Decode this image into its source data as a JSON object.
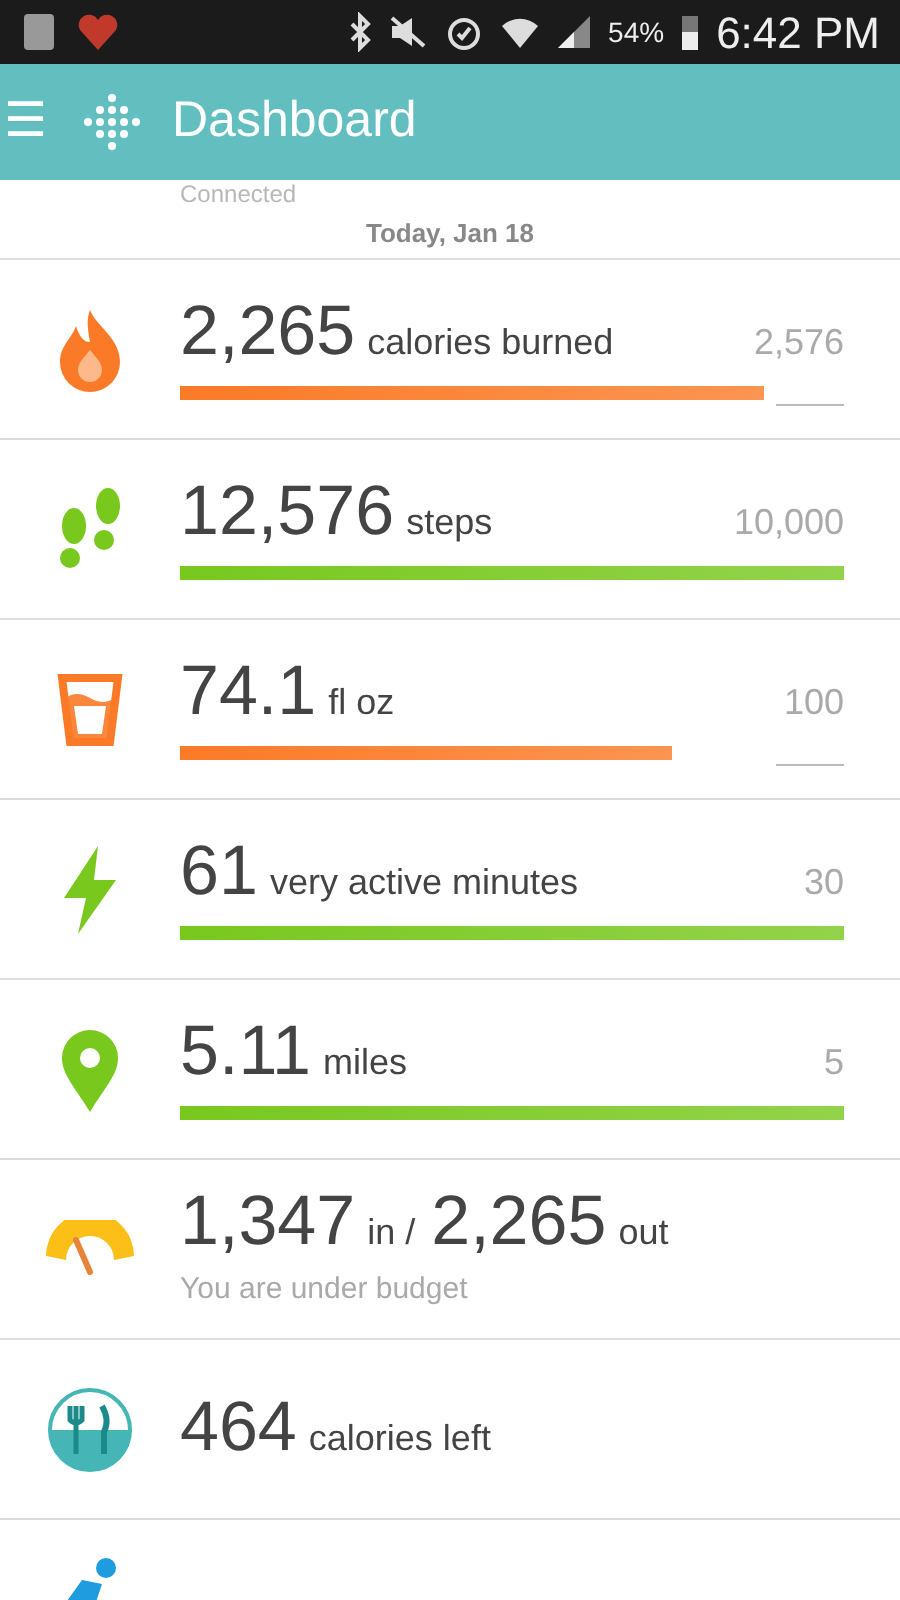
{
  "status_bar": {
    "battery": "54%",
    "time": "6:42 PM"
  },
  "header": {
    "menu": "☰",
    "title": "Dashboard"
  },
  "device": {
    "status": "Connected",
    "date": "Today, Jan 18"
  },
  "tiles": [
    {
      "kind": "calories",
      "value": "2,265",
      "unit": "calories burned",
      "goal": "2,576",
      "color": "#fb7a27"
    },
    {
      "kind": "steps",
      "value": "12,576",
      "unit": "steps",
      "goal": "10,000",
      "color": "#78c81e"
    },
    {
      "kind": "water",
      "value": "74.1",
      "unit": "fl oz",
      "goal": "100",
      "color": "#fb7a27"
    },
    {
      "kind": "active",
      "value": "61",
      "unit": "very active minutes",
      "goal": "30",
      "color": "#78c81e"
    },
    {
      "kind": "distance",
      "value": "5.11",
      "unit": "miles",
      "goal": "5",
      "color": "#78c81e"
    },
    {
      "kind": "budget",
      "value": "1,347",
      "unit": "in /",
      "value2": "2,265",
      "unit2": "out",
      "note": "You are under budget"
    },
    {
      "kind": "food",
      "value": "464",
      "unit": "calories left"
    },
    {
      "kind": "exercise"
    }
  ]
}
